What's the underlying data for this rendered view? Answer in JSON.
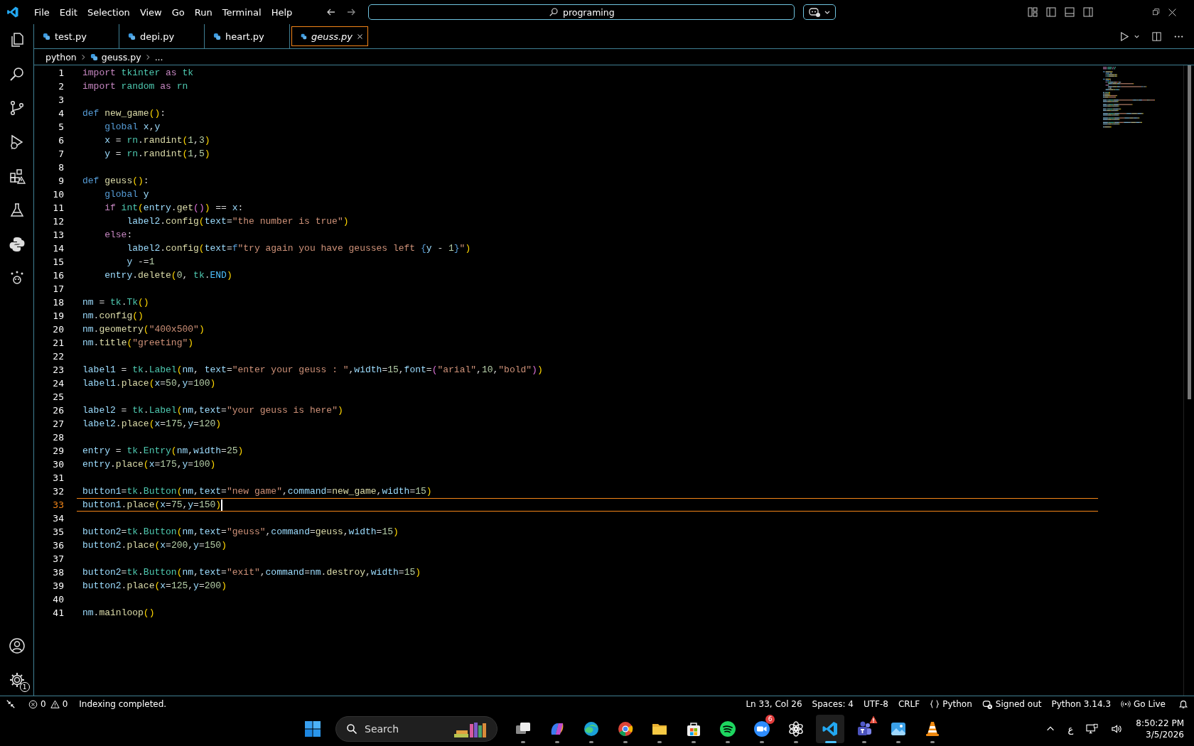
{
  "menu": [
    "File",
    "Edit",
    "Selection",
    "View",
    "Go",
    "Run",
    "Terminal",
    "Help"
  ],
  "command_center": {
    "text": "programing"
  },
  "tabs": [
    {
      "label": "test.py",
      "selected": false,
      "preview": false
    },
    {
      "label": "depi.py",
      "selected": false,
      "preview": false
    },
    {
      "label": "heart.py",
      "selected": false,
      "preview": false
    },
    {
      "label": "geuss.py",
      "selected": true,
      "preview": true
    }
  ],
  "breadcrumb": {
    "folder": "python",
    "file": "geuss.py",
    "more": "..."
  },
  "activity_bar": {
    "settings_badge": "1"
  },
  "editor": {
    "lines": [
      {
        "number": "1",
        "current": false,
        "tokens": [
          {
            "text": "import",
            "kind": "keyword"
          },
          {
            "text": " tkinter",
            "kind": "class"
          },
          {
            "text": " as",
            "kind": "keyword"
          },
          {
            "text": " tk",
            "kind": "class"
          }
        ]
      },
      {
        "number": "2",
        "current": false,
        "tokens": [
          {
            "text": "import",
            "kind": "keyword"
          },
          {
            "text": " random",
            "kind": "class"
          },
          {
            "text": " as",
            "kind": "keyword"
          },
          {
            "text": " rn",
            "kind": "class"
          }
        ]
      },
      {
        "number": "3",
        "current": false
      },
      {
        "number": "4",
        "current": false,
        "tokens": [
          {
            "text": "def",
            "kind": "storage"
          },
          {
            "text": " new_game",
            "kind": "function"
          },
          {
            "text": "()",
            "kind": "bracket1"
          },
          {
            "text": ":",
            "kind": "plain"
          }
        ]
      },
      {
        "number": "5",
        "current": false,
        "tokens": [
          {
            "text": "    global",
            "kind": "storage"
          },
          {
            "text": " x",
            "kind": "variable"
          },
          {
            "text": ",",
            "kind": "plain"
          },
          {
            "text": "y",
            "kind": "variable"
          }
        ]
      },
      {
        "number": "6",
        "current": false,
        "tokens": [
          {
            "text": "    x",
            "kind": "variable"
          },
          {
            "text": " = ",
            "kind": "plain"
          },
          {
            "text": "rn",
            "kind": "class"
          },
          {
            "text": ".",
            "kind": "plain"
          },
          {
            "text": "randint",
            "kind": "function"
          },
          {
            "text": "(",
            "kind": "bracket1"
          },
          {
            "text": "1",
            "kind": "number"
          },
          {
            "text": ",",
            "kind": "plain"
          },
          {
            "text": "3",
            "kind": "number"
          },
          {
            "text": ")",
            "kind": "bracket1"
          }
        ]
      },
      {
        "number": "7",
        "current": false,
        "tokens": [
          {
            "text": "    y",
            "kind": "variable"
          },
          {
            "text": " = ",
            "kind": "plain"
          },
          {
            "text": "rn",
            "kind": "class"
          },
          {
            "text": ".",
            "kind": "plain"
          },
          {
            "text": "randint",
            "kind": "function"
          },
          {
            "text": "(",
            "kind": "bracket1"
          },
          {
            "text": "1",
            "kind": "number"
          },
          {
            "text": ",",
            "kind": "plain"
          },
          {
            "text": "5",
            "kind": "number"
          },
          {
            "text": ")",
            "kind": "bracket1"
          }
        ]
      },
      {
        "number": "8",
        "current": false
      },
      {
        "number": "9",
        "current": false,
        "tokens": [
          {
            "text": "def",
            "kind": "storage"
          },
          {
            "text": " geuss",
            "kind": "function"
          },
          {
            "text": "()",
            "kind": "bracket1"
          },
          {
            "text": ":",
            "kind": "plain"
          }
        ]
      },
      {
        "number": "10",
        "current": false,
        "tokens": [
          {
            "text": "    global",
            "kind": "storage"
          },
          {
            "text": " y",
            "kind": "variable"
          }
        ]
      },
      {
        "number": "11",
        "current": false,
        "tokens": [
          {
            "text": "    if",
            "kind": "keyword"
          },
          {
            "text": " int",
            "kind": "class"
          },
          {
            "text": "(",
            "kind": "bracket1"
          },
          {
            "text": "entry",
            "kind": "variable"
          },
          {
            "text": ".",
            "kind": "plain"
          },
          {
            "text": "get",
            "kind": "function"
          },
          {
            "text": "()",
            "kind": "bracket2"
          },
          {
            "text": ")",
            "kind": "bracket1"
          },
          {
            "text": " == ",
            "kind": "plain"
          },
          {
            "text": "x",
            "kind": "variable"
          },
          {
            "text": ":",
            "kind": "plain"
          }
        ]
      },
      {
        "number": "12",
        "current": false,
        "tokens": [
          {
            "text": "        label2",
            "kind": "variable"
          },
          {
            "text": ".",
            "kind": "plain"
          },
          {
            "text": "config",
            "kind": "function"
          },
          {
            "text": "(",
            "kind": "bracket1"
          },
          {
            "text": "text",
            "kind": "variable"
          },
          {
            "text": "=",
            "kind": "plain"
          },
          {
            "text": "\"the number is true\"",
            "kind": "string"
          },
          {
            "text": ")",
            "kind": "bracket1"
          }
        ]
      },
      {
        "number": "13",
        "current": false,
        "tokens": [
          {
            "text": "    else",
            "kind": "keyword"
          },
          {
            "text": ":",
            "kind": "plain"
          }
        ]
      },
      {
        "number": "14",
        "current": false,
        "tokens": [
          {
            "text": "        label2",
            "kind": "variable"
          },
          {
            "text": ".",
            "kind": "plain"
          },
          {
            "text": "config",
            "kind": "function"
          },
          {
            "text": "(",
            "kind": "bracket1"
          },
          {
            "text": "text",
            "kind": "variable"
          },
          {
            "text": "=",
            "kind": "plain"
          },
          {
            "text": "f",
            "kind": "storage"
          },
          {
            "text": "\"try again you have geusses left ",
            "kind": "string"
          },
          {
            "text": "{",
            "kind": "storage"
          },
          {
            "text": "y",
            "kind": "variable"
          },
          {
            "text": " - ",
            "kind": "plain"
          },
          {
            "text": "1",
            "kind": "number"
          },
          {
            "text": "}",
            "kind": "storage"
          },
          {
            "text": "\"",
            "kind": "string"
          },
          {
            "text": ")",
            "kind": "bracket1"
          }
        ]
      },
      {
        "number": "15",
        "current": false,
        "tokens": [
          {
            "text": "        y",
            "kind": "variable"
          },
          {
            "text": " -=",
            "kind": "plain"
          },
          {
            "text": "1",
            "kind": "number"
          }
        ]
      },
      {
        "number": "16",
        "current": false,
        "tokens": [
          {
            "text": "    entry",
            "kind": "variable"
          },
          {
            "text": ".",
            "kind": "plain"
          },
          {
            "text": "delete",
            "kind": "function"
          },
          {
            "text": "(",
            "kind": "bracket1"
          },
          {
            "text": "0",
            "kind": "number"
          },
          {
            "text": ", ",
            "kind": "plain"
          },
          {
            "text": "tk",
            "kind": "class"
          },
          {
            "text": ".",
            "kind": "plain"
          },
          {
            "text": "END",
            "kind": "constant"
          },
          {
            "text": ")",
            "kind": "bracket1"
          }
        ]
      },
      {
        "number": "17",
        "current": false
      },
      {
        "number": "18",
        "current": false,
        "tokens": [
          {
            "text": "nm",
            "kind": "variable"
          },
          {
            "text": " = ",
            "kind": "plain"
          },
          {
            "text": "tk",
            "kind": "class"
          },
          {
            "text": ".",
            "kind": "plain"
          },
          {
            "text": "Tk",
            "kind": "class"
          },
          {
            "text": "()",
            "kind": "bracket1"
          }
        ]
      },
      {
        "number": "19",
        "current": false,
        "tokens": [
          {
            "text": "nm",
            "kind": "variable"
          },
          {
            "text": ".",
            "kind": "plain"
          },
          {
            "text": "config",
            "kind": "function"
          },
          {
            "text": "()",
            "kind": "bracket1"
          }
        ]
      },
      {
        "number": "20",
        "current": false,
        "tokens": [
          {
            "text": "nm",
            "kind": "variable"
          },
          {
            "text": ".",
            "kind": "plain"
          },
          {
            "text": "geometry",
            "kind": "function"
          },
          {
            "text": "(",
            "kind": "bracket1"
          },
          {
            "text": "\"400x500\"",
            "kind": "string"
          },
          {
            "text": ")",
            "kind": "bracket1"
          }
        ]
      },
      {
        "number": "21",
        "current": false,
        "tokens": [
          {
            "text": "nm",
            "kind": "variable"
          },
          {
            "text": ".",
            "kind": "plain"
          },
          {
            "text": "title",
            "kind": "function"
          },
          {
            "text": "(",
            "kind": "bracket1"
          },
          {
            "text": "\"greeting\"",
            "kind": "string"
          },
          {
            "text": ")",
            "kind": "bracket1"
          }
        ]
      },
      {
        "number": "22",
        "current": false
      },
      {
        "number": "23",
        "current": false,
        "tokens": [
          {
            "text": "label1",
            "kind": "variable"
          },
          {
            "text": " = ",
            "kind": "plain"
          },
          {
            "text": "tk",
            "kind": "class"
          },
          {
            "text": ".",
            "kind": "plain"
          },
          {
            "text": "Label",
            "kind": "class"
          },
          {
            "text": "(",
            "kind": "bracket1"
          },
          {
            "text": "nm",
            "kind": "variable"
          },
          {
            "text": ", ",
            "kind": "plain"
          },
          {
            "text": "text",
            "kind": "variable"
          },
          {
            "text": "=",
            "kind": "plain"
          },
          {
            "text": "\"enter your geuss : \"",
            "kind": "string"
          },
          {
            "text": ",",
            "kind": "plain"
          },
          {
            "text": "width",
            "kind": "variable"
          },
          {
            "text": "=",
            "kind": "plain"
          },
          {
            "text": "15",
            "kind": "number"
          },
          {
            "text": ",",
            "kind": "plain"
          },
          {
            "text": "font",
            "kind": "variable"
          },
          {
            "text": "=",
            "kind": "plain"
          },
          {
            "text": "(",
            "kind": "bracket2"
          },
          {
            "text": "\"arial\"",
            "kind": "string"
          },
          {
            "text": ",",
            "kind": "plain"
          },
          {
            "text": "10",
            "kind": "number"
          },
          {
            "text": ",",
            "kind": "plain"
          },
          {
            "text": "\"bold\"",
            "kind": "string"
          },
          {
            "text": ")",
            "kind": "bracket2"
          },
          {
            "text": ")",
            "kind": "bracket1"
          }
        ]
      },
      {
        "number": "24",
        "current": false,
        "tokens": [
          {
            "text": "label1",
            "kind": "variable"
          },
          {
            "text": ".",
            "kind": "plain"
          },
          {
            "text": "place",
            "kind": "function"
          },
          {
            "text": "(",
            "kind": "bracket1"
          },
          {
            "text": "x",
            "kind": "variable"
          },
          {
            "text": "=",
            "kind": "plain"
          },
          {
            "text": "50",
            "kind": "number"
          },
          {
            "text": ",",
            "kind": "plain"
          },
          {
            "text": "y",
            "kind": "variable"
          },
          {
            "text": "=",
            "kind": "plain"
          },
          {
            "text": "100",
            "kind": "number"
          },
          {
            "text": ")",
            "kind": "bracket1"
          }
        ]
      },
      {
        "number": "25",
        "current": false
      },
      {
        "number": "26",
        "current": false,
        "tokens": [
          {
            "text": "label2",
            "kind": "variable"
          },
          {
            "text": " = ",
            "kind": "plain"
          },
          {
            "text": "tk",
            "kind": "class"
          },
          {
            "text": ".",
            "kind": "plain"
          },
          {
            "text": "Label",
            "kind": "class"
          },
          {
            "text": "(",
            "kind": "bracket1"
          },
          {
            "text": "nm",
            "kind": "variable"
          },
          {
            "text": ",",
            "kind": "plain"
          },
          {
            "text": "text",
            "kind": "variable"
          },
          {
            "text": "=",
            "kind": "plain"
          },
          {
            "text": "\"your geuss is here\"",
            "kind": "string"
          },
          {
            "text": ")",
            "kind": "bracket1"
          }
        ]
      },
      {
        "number": "27",
        "current": false,
        "tokens": [
          {
            "text": "label2",
            "kind": "variable"
          },
          {
            "text": ".",
            "kind": "plain"
          },
          {
            "text": "place",
            "kind": "function"
          },
          {
            "text": "(",
            "kind": "bracket1"
          },
          {
            "text": "x",
            "kind": "variable"
          },
          {
            "text": "=",
            "kind": "plain"
          },
          {
            "text": "175",
            "kind": "number"
          },
          {
            "text": ",",
            "kind": "plain"
          },
          {
            "text": "y",
            "kind": "variable"
          },
          {
            "text": "=",
            "kind": "plain"
          },
          {
            "text": "120",
            "kind": "number"
          },
          {
            "text": ")",
            "kind": "bracket1"
          }
        ]
      },
      {
        "number": "28",
        "current": false
      },
      {
        "number": "29",
        "current": false,
        "tokens": [
          {
            "text": "entry",
            "kind": "variable"
          },
          {
            "text": " = ",
            "kind": "plain"
          },
          {
            "text": "tk",
            "kind": "class"
          },
          {
            "text": ".",
            "kind": "plain"
          },
          {
            "text": "Entry",
            "kind": "class"
          },
          {
            "text": "(",
            "kind": "bracket1"
          },
          {
            "text": "nm",
            "kind": "variable"
          },
          {
            "text": ",",
            "kind": "plain"
          },
          {
            "text": "width",
            "kind": "variable"
          },
          {
            "text": "=",
            "kind": "plain"
          },
          {
            "text": "25",
            "kind": "number"
          },
          {
            "text": ")",
            "kind": "bracket1"
          }
        ]
      },
      {
        "number": "30",
        "current": false,
        "tokens": [
          {
            "text": "entry",
            "kind": "variable"
          },
          {
            "text": ".",
            "kind": "plain"
          },
          {
            "text": "place",
            "kind": "function"
          },
          {
            "text": "(",
            "kind": "bracket1"
          },
          {
            "text": "x",
            "kind": "variable"
          },
          {
            "text": "=",
            "kind": "plain"
          },
          {
            "text": "175",
            "kind": "number"
          },
          {
            "text": ",",
            "kind": "plain"
          },
          {
            "text": "y",
            "kind": "variable"
          },
          {
            "text": "=",
            "kind": "plain"
          },
          {
            "text": "100",
            "kind": "number"
          },
          {
            "text": ")",
            "kind": "bracket1"
          }
        ]
      },
      {
        "number": "31",
        "current": false
      },
      {
        "number": "32",
        "current": false,
        "tokens": [
          {
            "text": "button1",
            "kind": "variable"
          },
          {
            "text": "=",
            "kind": "plain"
          },
          {
            "text": "tk",
            "kind": "class"
          },
          {
            "text": ".",
            "kind": "plain"
          },
          {
            "text": "Button",
            "kind": "class"
          },
          {
            "text": "(",
            "kind": "bracket1"
          },
          {
            "text": "nm",
            "kind": "variable"
          },
          {
            "text": ",",
            "kind": "plain"
          },
          {
            "text": "text",
            "kind": "variable"
          },
          {
            "text": "=",
            "kind": "plain"
          },
          {
            "text": "\"new game\"",
            "kind": "string"
          },
          {
            "text": ",",
            "kind": "plain"
          },
          {
            "text": "command",
            "kind": "variable"
          },
          {
            "text": "=",
            "kind": "plain"
          },
          {
            "text": "new_game",
            "kind": "function"
          },
          {
            "text": ",",
            "kind": "plain"
          },
          {
            "text": "width",
            "kind": "variable"
          },
          {
            "text": "=",
            "kind": "plain"
          },
          {
            "text": "15",
            "kind": "number"
          },
          {
            "text": ")",
            "kind": "bracket1"
          }
        ]
      },
      {
        "number": "33",
        "current": true,
        "tokens": [
          {
            "text": "button1",
            "kind": "variable"
          },
          {
            "text": ".",
            "kind": "plain"
          },
          {
            "text": "place",
            "kind": "function"
          },
          {
            "text": "(",
            "kind": "bracket1"
          },
          {
            "text": "x",
            "kind": "variable"
          },
          {
            "text": "=",
            "kind": "plain"
          },
          {
            "text": "75",
            "kind": "number"
          },
          {
            "text": ",",
            "kind": "plain"
          },
          {
            "text": "y",
            "kind": "variable"
          },
          {
            "text": "=",
            "kind": "plain"
          },
          {
            "text": "150",
            "kind": "number"
          },
          {
            "text": ")",
            "kind": "bracket1"
          }
        ]
      },
      {
        "number": "34",
        "current": false
      },
      {
        "number": "35",
        "current": false,
        "tokens": [
          {
            "text": "button2",
            "kind": "variable"
          },
          {
            "text": "=",
            "kind": "plain"
          },
          {
            "text": "tk",
            "kind": "class"
          },
          {
            "text": ".",
            "kind": "plain"
          },
          {
            "text": "Button",
            "kind": "class"
          },
          {
            "text": "(",
            "kind": "bracket1"
          },
          {
            "text": "nm",
            "kind": "variable"
          },
          {
            "text": ",",
            "kind": "plain"
          },
          {
            "text": "text",
            "kind": "variable"
          },
          {
            "text": "=",
            "kind": "plain"
          },
          {
            "text": "\"geuss\"",
            "kind": "string"
          },
          {
            "text": ",",
            "kind": "plain"
          },
          {
            "text": "command",
            "kind": "variable"
          },
          {
            "text": "=",
            "kind": "plain"
          },
          {
            "text": "geuss",
            "kind": "function"
          },
          {
            "text": ",",
            "kind": "plain"
          },
          {
            "text": "width",
            "kind": "variable"
          },
          {
            "text": "=",
            "kind": "plain"
          },
          {
            "text": "15",
            "kind": "number"
          },
          {
            "text": ")",
            "kind": "bracket1"
          }
        ]
      },
      {
        "number": "36",
        "current": false,
        "tokens": [
          {
            "text": "button2",
            "kind": "variable"
          },
          {
            "text": ".",
            "kind": "plain"
          },
          {
            "text": "place",
            "kind": "function"
          },
          {
            "text": "(",
            "kind": "bracket1"
          },
          {
            "text": "x",
            "kind": "variable"
          },
          {
            "text": "=",
            "kind": "plain"
          },
          {
            "text": "200",
            "kind": "number"
          },
          {
            "text": ",",
            "kind": "plain"
          },
          {
            "text": "y",
            "kind": "variable"
          },
          {
            "text": "=",
            "kind": "plain"
          },
          {
            "text": "150",
            "kind": "number"
          },
          {
            "text": ")",
            "kind": "bracket1"
          }
        ]
      },
      {
        "number": "37",
        "current": false
      },
      {
        "number": "38",
        "current": false,
        "tokens": [
          {
            "text": "button2",
            "kind": "variable"
          },
          {
            "text": "=",
            "kind": "plain"
          },
          {
            "text": "tk",
            "kind": "class"
          },
          {
            "text": ".",
            "kind": "plain"
          },
          {
            "text": "Button",
            "kind": "class"
          },
          {
            "text": "(",
            "kind": "bracket1"
          },
          {
            "text": "nm",
            "kind": "variable"
          },
          {
            "text": ",",
            "kind": "plain"
          },
          {
            "text": "text",
            "kind": "variable"
          },
          {
            "text": "=",
            "kind": "plain"
          },
          {
            "text": "\"exit\"",
            "kind": "string"
          },
          {
            "text": ",",
            "kind": "plain"
          },
          {
            "text": "command",
            "kind": "variable"
          },
          {
            "text": "=",
            "kind": "plain"
          },
          {
            "text": "nm",
            "kind": "variable"
          },
          {
            "text": ".",
            "kind": "plain"
          },
          {
            "text": "destroy",
            "kind": "function"
          },
          {
            "text": ",",
            "kind": "plain"
          },
          {
            "text": "width",
            "kind": "variable"
          },
          {
            "text": "=",
            "kind": "plain"
          },
          {
            "text": "15",
            "kind": "number"
          },
          {
            "text": ")",
            "kind": "bracket1"
          }
        ]
      },
      {
        "number": "39",
        "current": false,
        "tokens": [
          {
            "text": "button2",
            "kind": "variable"
          },
          {
            "text": ".",
            "kind": "plain"
          },
          {
            "text": "place",
            "kind": "function"
          },
          {
            "text": "(",
            "kind": "bracket1"
          },
          {
            "text": "x",
            "kind": "variable"
          },
          {
            "text": "=",
            "kind": "plain"
          },
          {
            "text": "125",
            "kind": "number"
          },
          {
            "text": ",",
            "kind": "plain"
          },
          {
            "text": "y",
            "kind": "variable"
          },
          {
            "text": "=",
            "kind": "plain"
          },
          {
            "text": "200",
            "kind": "number"
          },
          {
            "text": ")",
            "kind": "bracket1"
          }
        ]
      },
      {
        "number": "40",
        "current": false
      },
      {
        "number": "41",
        "current": false,
        "tokens": [
          {
            "text": "nm",
            "kind": "variable"
          },
          {
            "text": ".",
            "kind": "plain"
          },
          {
            "text": "mainloop",
            "kind": "function"
          },
          {
            "text": "()",
            "kind": "bracket1"
          }
        ]
      }
    ]
  },
  "status_bar": {
    "errors": "0",
    "warnings": "0",
    "message": "Indexing completed.",
    "position": "Ln 33, Col 26",
    "indent": "Spaces: 4",
    "encoding": "UTF-8",
    "eol": "CRLF",
    "language": "Python",
    "account": "Signed out",
    "interpreter": "Python 3.14.3",
    "live": "Go Live"
  },
  "taskbar": {
    "search_placeholder": "Search",
    "apps": [
      {
        "kind": "taskview",
        "active": false
      },
      {
        "kind": "assistant",
        "active": false
      },
      {
        "kind": "browser-blue",
        "active": false
      },
      {
        "kind": "browser",
        "active": false
      },
      {
        "kind": "folder",
        "active": false
      },
      {
        "kind": "store",
        "active": false
      },
      {
        "kind": "music",
        "active": false
      },
      {
        "kind": "videocall",
        "active": false,
        "badge": "6"
      },
      {
        "kind": "chat",
        "active": false
      },
      {
        "kind": "editor",
        "active": true
      },
      {
        "kind": "team",
        "active": false,
        "warning": true
      },
      {
        "kind": "photos",
        "active": false
      },
      {
        "kind": "cone",
        "active": false
      }
    ],
    "language": "ع",
    "time": "8:50:22 PM",
    "date": "3/5/2026"
  }
}
